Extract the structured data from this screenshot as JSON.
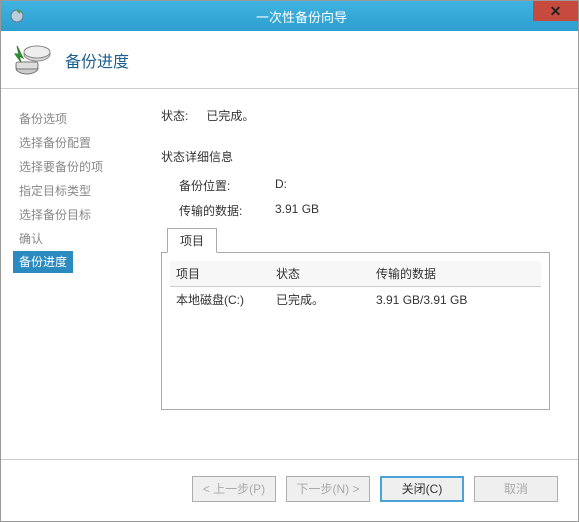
{
  "window": {
    "title": "一次性备份向导",
    "close_symbol": "✕"
  },
  "header": {
    "title": "备份进度"
  },
  "sidebar": {
    "steps": [
      "备份选项",
      "选择备份配置",
      "选择要备份的项",
      "指定目标类型",
      "选择备份目标",
      "确认",
      "备份进度"
    ],
    "active_index": 6
  },
  "content": {
    "status_label": "状态:",
    "status_value": "已完成。",
    "detail_title": "状态详细信息",
    "location_label": "备份位置:",
    "location_value": "D:",
    "data_label": "传输的数据:",
    "data_value": "3.91 GB",
    "tab_label": "项目",
    "table": {
      "headers": [
        "项目",
        "状态",
        "传输的数据"
      ],
      "rows": [
        [
          "本地磁盘(C:)",
          "已完成。",
          "3.91 GB/3.91 GB"
        ]
      ]
    }
  },
  "buttons": {
    "prev": "< 上一步(P)",
    "next": "下一步(N) >",
    "close": "关闭(C)",
    "cancel": "取消"
  }
}
